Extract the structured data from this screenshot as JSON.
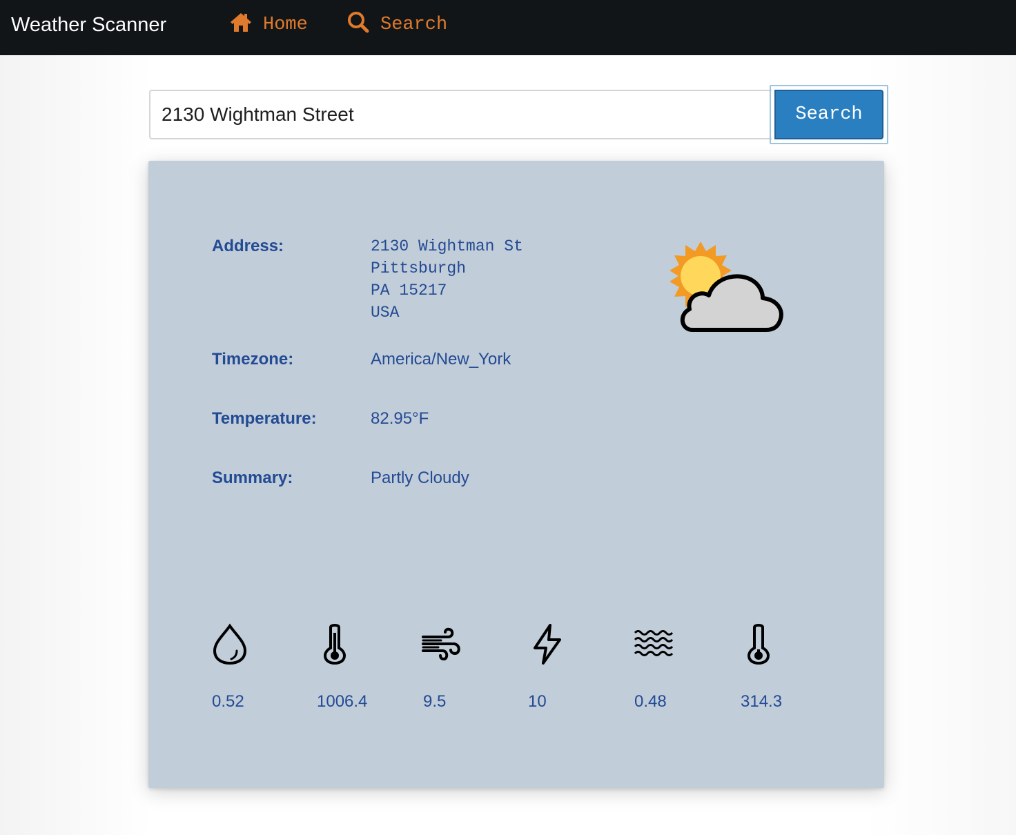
{
  "app": {
    "title": "Weather Scanner"
  },
  "nav": {
    "items": [
      {
        "label": "Home",
        "icon": "home-icon"
      },
      {
        "label": "Search",
        "icon": "search-icon"
      }
    ]
  },
  "search": {
    "value": "2130 Wightman Street",
    "button_label": "Search"
  },
  "result": {
    "labels": {
      "address": "Address:",
      "timezone": "Timezone:",
      "temperature": "Temperature:",
      "summary": "Summary:"
    },
    "address_lines": [
      "2130 Wightman St",
      "Pittsburgh",
      "PA 15217",
      "USA"
    ],
    "timezone": "America/New_York",
    "temperature": "82.95°F",
    "summary": "Partly Cloudy",
    "summary_icon": "partly-cloudy-icon",
    "stats": [
      {
        "icon": "raindrop-icon",
        "value": "0.52"
      },
      {
        "icon": "thermometer-icon",
        "value": "1006.4"
      },
      {
        "icon": "wind-icon",
        "value": "9.5"
      },
      {
        "icon": "lightning-icon",
        "value": "10"
      },
      {
        "icon": "waves-icon",
        "value": "0.48"
      },
      {
        "icon": "thermometer-low-icon",
        "value": "314.3"
      }
    ]
  },
  "colors": {
    "navbar": "#111518",
    "nav_link": "#e07a2d",
    "button": "#2a7fc1",
    "card": "#c1cdd8",
    "text": "#234a94"
  }
}
